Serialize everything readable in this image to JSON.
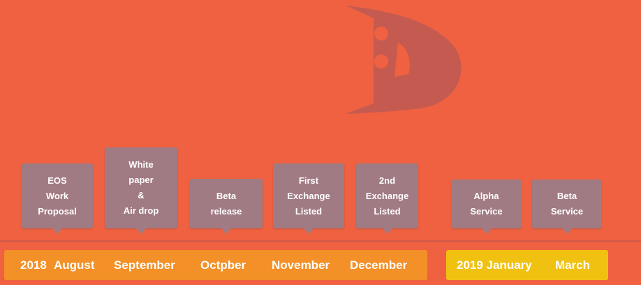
{
  "logo": {
    "icon": "d-face-logo-icon",
    "color": "#c55b50"
  },
  "milestones": [
    {
      "text": "EOS\nWork\nProposal"
    },
    {
      "text": "White\npaper\n&\nAir drop"
    },
    {
      "text": "Beta\nrelease"
    },
    {
      "text": "First\nExchange\nListed"
    },
    {
      "text": "2nd\nExchange\nListed"
    },
    {
      "text": "Alpha\nService"
    },
    {
      "text": "Beta\nService"
    }
  ],
  "timeline": {
    "year_2018": "2018",
    "month_aug": "August",
    "month_sep": "September",
    "month_oct": "Octpber",
    "month_nov": "November",
    "month_dec": "December",
    "year_2019_label": "2019 January",
    "month_mar": "March"
  },
  "colors": {
    "background": "#ef6140",
    "bubble": "#a17b83",
    "bar_2018": "#f39027",
    "bar_2019": "#f1c112"
  }
}
